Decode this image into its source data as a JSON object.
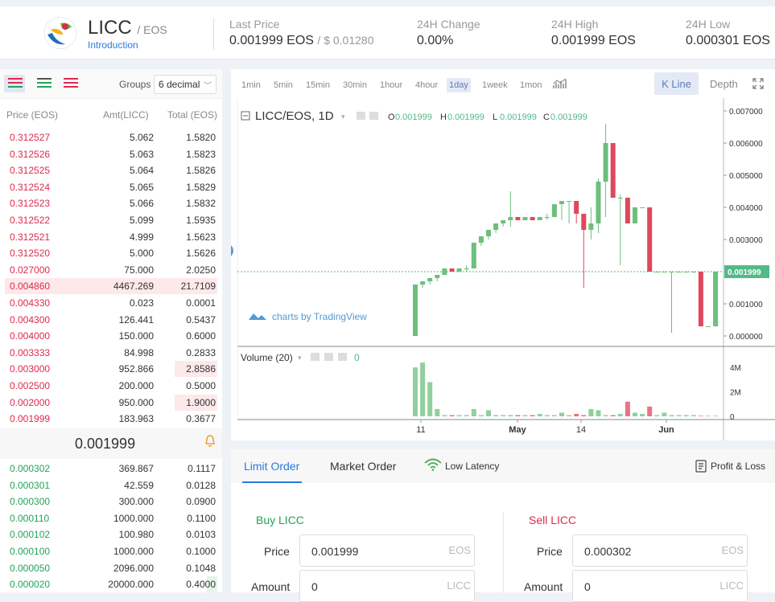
{
  "header": {
    "pair": "LICC",
    "quote": "/ EOS",
    "intro": "Introduction",
    "stats": [
      {
        "label": "Last Price",
        "value": "0.001999 EOS",
        "sub": "/ $ 0.01280"
      },
      {
        "label": "24H Change",
        "value": "0.00%",
        "sub": ""
      },
      {
        "label": "24H High",
        "value": "0.001999 EOS",
        "sub": ""
      },
      {
        "label": "24H Low",
        "value": "0.000301 EOS",
        "sub": ""
      }
    ]
  },
  "orderbook": {
    "groups_label": "Groups",
    "groups_value": "6 decimal",
    "headers": {
      "price": "Price (EOS)",
      "amount": "Amt(LICC)",
      "total": "Total (EOS)"
    },
    "asks": [
      {
        "price": "0.312527",
        "amount": "5.062",
        "total": "1.5820",
        "depth": 0
      },
      {
        "price": "0.312526",
        "amount": "5.063",
        "total": "1.5823",
        "depth": 0
      },
      {
        "price": "0.312525",
        "amount": "5.064",
        "total": "1.5826",
        "depth": 0
      },
      {
        "price": "0.312524",
        "amount": "5.065",
        "total": "1.5829",
        "depth": 0
      },
      {
        "price": "0.312523",
        "amount": "5.066",
        "total": "1.5832",
        "depth": 0
      },
      {
        "price": "0.312522",
        "amount": "5.099",
        "total": "1.5935",
        "depth": 0
      },
      {
        "price": "0.312521",
        "amount": "4.999",
        "total": "1.5623",
        "depth": 0
      },
      {
        "price": "0.312520",
        "amount": "5.000",
        "total": "1.5626",
        "depth": 0
      },
      {
        "price": "0.027000",
        "amount": "75.000",
        "total": "2.0250",
        "depth": 0
      },
      {
        "price": "0.004860",
        "amount": "4467.269",
        "total": "21.7109",
        "depth": 1.0
      },
      {
        "price": "0.004330",
        "amount": "0.023",
        "total": "0.0001",
        "depth": 0
      },
      {
        "price": "0.004300",
        "amount": "126.441",
        "total": "0.5437",
        "depth": 0
      },
      {
        "price": "0.004000",
        "amount": "150.000",
        "total": "0.6000",
        "depth": 0
      },
      {
        "price": "0.003333",
        "amount": "84.998",
        "total": "0.2833",
        "depth": 0
      },
      {
        "price": "0.003000",
        "amount": "952.866",
        "total": "2.8586",
        "depth": 0.2
      },
      {
        "price": "0.002500",
        "amount": "200.000",
        "total": "0.5000",
        "depth": 0
      },
      {
        "price": "0.002000",
        "amount": "950.000",
        "total": "1.9000",
        "depth": 0.2
      },
      {
        "price": "0.001999",
        "amount": "183.963",
        "total": "0.3677",
        "depth": 0
      }
    ],
    "last_price": "0.001999",
    "bids": [
      {
        "price": "0.000302",
        "amount": "369.867",
        "total": "0.1117",
        "depth": 0
      },
      {
        "price": "0.000301",
        "amount": "42.559",
        "total": "0.0128",
        "depth": 0
      },
      {
        "price": "0.000300",
        "amount": "300.000",
        "total": "0.0900",
        "depth": 0
      },
      {
        "price": "0.000110",
        "amount": "1000.000",
        "total": "0.1100",
        "depth": 0
      },
      {
        "price": "0.000102",
        "amount": "100.980",
        "total": "0.0103",
        "depth": 0
      },
      {
        "price": "0.000100",
        "amount": "1000.000",
        "total": "0.1000",
        "depth": 0
      },
      {
        "price": "0.000050",
        "amount": "2096.000",
        "total": "0.1048",
        "depth": 0
      },
      {
        "price": "0.000020",
        "amount": "20000.000",
        "total": "0.4000",
        "depth": 0.05
      }
    ]
  },
  "chart": {
    "intervals": [
      "1min",
      "5min",
      "15min",
      "30min",
      "1hour",
      "4hour",
      "1day",
      "1week",
      "1mon"
    ],
    "active_interval": "1day",
    "kline_label": "K Line",
    "depth_label": "Depth",
    "symbol": "LICC/EOS, 1D",
    "ohlc": {
      "o": "0.001999",
      "h": "0.001999",
      "l": "0.001999",
      "c": "0.001999"
    },
    "watermark": "charts by TradingView",
    "volume_label": "Volume (20)",
    "volume_value": "0",
    "price_ticks": [
      "0.007000",
      "0.006000",
      "0.005000",
      "0.004000",
      "0.003000",
      "0.001999",
      "0.001000",
      "0.000000"
    ],
    "volume_ticks": [
      "4M",
      "2M",
      "0"
    ],
    "x_ticks": [
      "11",
      "May",
      "14",
      "Jun"
    ],
    "colors": {
      "up": "#6cbf7c",
      "down": "#e0475b",
      "price_tag": "#53b987"
    }
  },
  "chart_data": {
    "type": "candlestick",
    "ylim": [
      0,
      0.0072
    ],
    "current_price": 0.001999,
    "candles": [
      {
        "o": 0.0,
        "h": 0.0016,
        "l": 0.0,
        "c": 0.0016
      },
      {
        "o": 0.0016,
        "h": 0.0017,
        "l": 0.0015,
        "c": 0.0017
      },
      {
        "o": 0.0017,
        "h": 0.0018,
        "l": 0.0016,
        "c": 0.0018
      },
      {
        "o": 0.0018,
        "h": 0.0019,
        "l": 0.0017,
        "c": 0.0019
      },
      {
        "o": 0.0019,
        "h": 0.0021,
        "l": 0.0019,
        "c": 0.0021
      },
      {
        "o": 0.0021,
        "h": 0.0021,
        "l": 0.002,
        "c": 0.002
      },
      {
        "o": 0.002,
        "h": 0.0021,
        "l": 0.002,
        "c": 0.0021
      },
      {
        "o": 0.0021,
        "h": 0.0022,
        "l": 0.002,
        "c": 0.0021
      },
      {
        "o": 0.0021,
        "h": 0.0029,
        "l": 0.0021,
        "c": 0.0029
      },
      {
        "o": 0.0029,
        "h": 0.0031,
        "l": 0.0028,
        "c": 0.0031
      },
      {
        "o": 0.0031,
        "h": 0.0033,
        "l": 0.003,
        "c": 0.0033
      },
      {
        "o": 0.0033,
        "h": 0.0035,
        "l": 0.0032,
        "c": 0.0035
      },
      {
        "o": 0.0035,
        "h": 0.0036,
        "l": 0.0034,
        "c": 0.0036
      },
      {
        "o": 0.0036,
        "h": 0.0045,
        "l": 0.0034,
        "c": 0.0037
      },
      {
        "o": 0.0037,
        "h": 0.0037,
        "l": 0.0036,
        "c": 0.0036
      },
      {
        "o": 0.0036,
        "h": 0.0037,
        "l": 0.0036,
        "c": 0.0037
      },
      {
        "o": 0.0037,
        "h": 0.0037,
        "l": 0.0036,
        "c": 0.0036
      },
      {
        "o": 0.0036,
        "h": 0.0037,
        "l": 0.0036,
        "c": 0.0037
      },
      {
        "o": 0.0037,
        "h": 0.0038,
        "l": 0.0036,
        "c": 0.0037
      },
      {
        "o": 0.0037,
        "h": 0.0041,
        "l": 0.0037,
        "c": 0.0041
      },
      {
        "o": 0.0041,
        "h": 0.0042,
        "l": 0.0036,
        "c": 0.0042
      },
      {
        "o": 0.0042,
        "h": 0.0042,
        "l": 0.0035,
        "c": 0.0042
      },
      {
        "o": 0.0042,
        "h": 0.0042,
        "l": 0.0035,
        "c": 0.0038
      },
      {
        "o": 0.0038,
        "h": 0.0038,
        "l": 0.0015,
        "c": 0.0033
      },
      {
        "o": 0.0033,
        "h": 0.004,
        "l": 0.003,
        "c": 0.0035
      },
      {
        "o": 0.0035,
        "h": 0.0049,
        "l": 0.0032,
        "c": 0.0048
      },
      {
        "o": 0.0048,
        "h": 0.0066,
        "l": 0.0037,
        "c": 0.006
      },
      {
        "o": 0.006,
        "h": 0.006,
        "l": 0.0043,
        "c": 0.0043
      },
      {
        "o": 0.0043,
        "h": 0.0044,
        "l": 0.0022,
        "c": 0.0043
      },
      {
        "o": 0.0043,
        "h": 0.0043,
        "l": 0.0035,
        "c": 0.0035
      },
      {
        "o": 0.0035,
        "h": 0.004,
        "l": 0.0035,
        "c": 0.004
      },
      {
        "o": 0.004,
        "h": 0.004,
        "l": 0.004,
        "c": 0.004
      },
      {
        "o": 0.004,
        "h": 0.004,
        "l": 0.002,
        "c": 0.002
      },
      {
        "o": 0.002,
        "h": 0.002,
        "l": 0.002,
        "c": 0.002
      },
      {
        "o": 0.002,
        "h": 0.002,
        "l": 0.002,
        "c": 0.002
      },
      {
        "o": 0.002,
        "h": 0.002,
        "l": 0.0001,
        "c": 0.002
      },
      {
        "o": 0.002,
        "h": 0.002,
        "l": 0.002,
        "c": 0.002
      },
      {
        "o": 0.002,
        "h": 0.002,
        "l": 0.002,
        "c": 0.002
      },
      {
        "o": 0.002,
        "h": 0.002,
        "l": 0.002,
        "c": 0.002
      },
      {
        "o": 0.002,
        "h": 0.002,
        "l": 0.0003,
        "c": 0.0003
      },
      {
        "o": 0.0003,
        "h": 0.0003,
        "l": 0.0003,
        "c": 0.0003
      },
      {
        "o": 0.0003,
        "h": 0.002,
        "l": 0.0003,
        "c": 0.002
      }
    ],
    "volumes": [
      4.0,
      4.4,
      2.8,
      0.6,
      0.1,
      0.1,
      0.1,
      0.1,
      0.6,
      0.1,
      0.5,
      0.1,
      0.1,
      0.1,
      0.1,
      0.1,
      0.1,
      0.2,
      0.1,
      0.1,
      0.3,
      0.1,
      0.2,
      0.1,
      0.6,
      0.5,
      0.1,
      0.1,
      0.2,
      1.2,
      0.3,
      0.2,
      0.8,
      0.1,
      0.3,
      0.1,
      0.1,
      0.1,
      0.1,
      0.05,
      0.05,
      0.05
    ]
  },
  "trade": {
    "tabs": [
      "Limit Order",
      "Market Order"
    ],
    "latency": "Low Latency",
    "pnl": "Profit & Loss",
    "buy_title": "Buy LICC",
    "sell_title": "Sell LICC",
    "price_label": "Price",
    "amount_label": "Amount",
    "buy_price": "0.001999",
    "sell_price": "0.000302",
    "buy_amount": "0",
    "sell_amount": "0",
    "quote_unit": "EOS",
    "base_unit": "LICC",
    "buy_color": "#22a35a",
    "sell_color": "#e0294a"
  }
}
